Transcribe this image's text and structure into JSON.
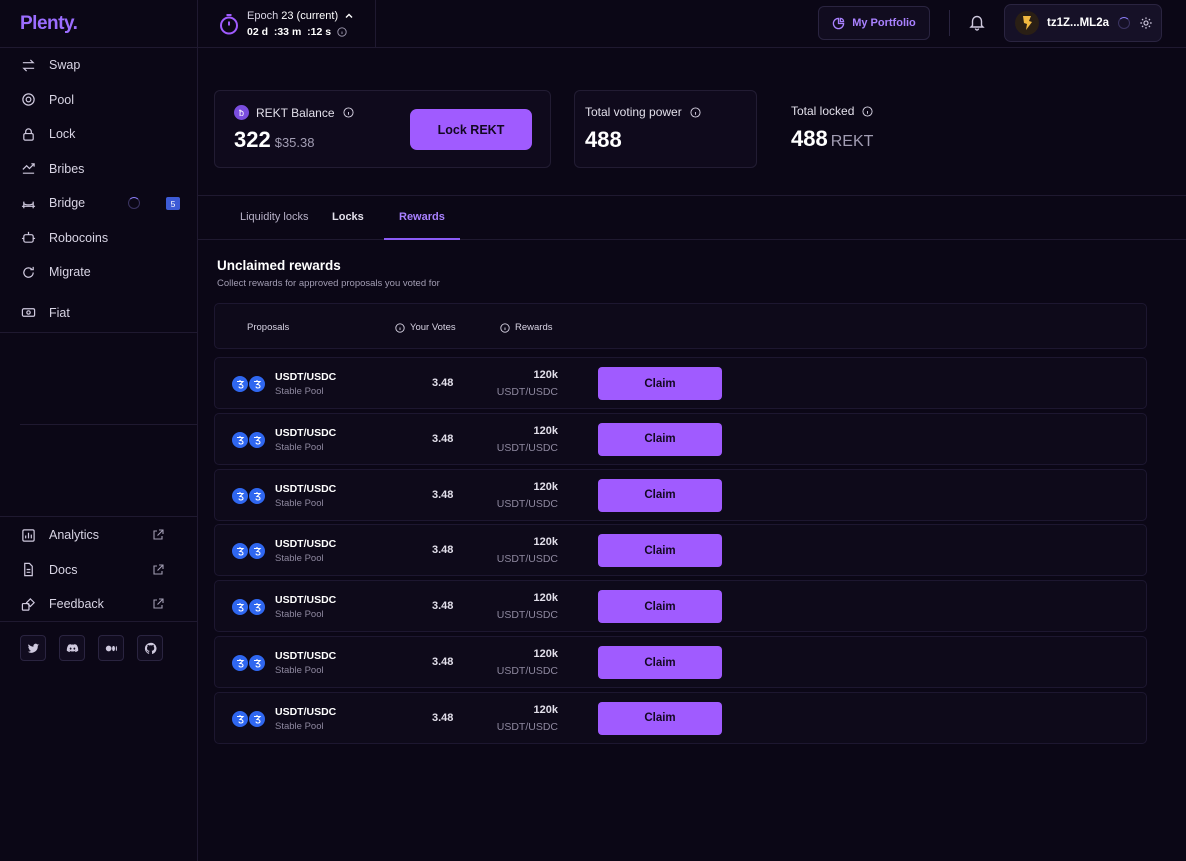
{
  "brand": {
    "logo": "Plenty."
  },
  "sidebar": {
    "items": [
      {
        "label": "Swap",
        "icon": "swap-icon"
      },
      {
        "label": "Pool",
        "icon": "pool-icon"
      },
      {
        "label": "Lock",
        "icon": "lock-icon"
      },
      {
        "label": "Bribes",
        "icon": "bribes-icon"
      },
      {
        "label": "Bridge",
        "icon": "bridge-icon",
        "badge": "5"
      },
      {
        "label": "Robocoins",
        "icon": "robot-icon"
      },
      {
        "label": "Migrate",
        "icon": "migrate-icon"
      },
      {
        "label": "Fiat",
        "icon": "fiat-icon"
      }
    ],
    "bottom": [
      {
        "label": "Analytics",
        "icon": "analytics-icon"
      },
      {
        "label": "Docs",
        "icon": "docs-icon"
      },
      {
        "label": "Feedback",
        "icon": "feedback-icon"
      }
    ],
    "socials": [
      "twitter-icon",
      "discord-icon",
      "medium-icon",
      "github-icon"
    ]
  },
  "header": {
    "epoch_label": "Epoch",
    "epoch_number": "23 (current)",
    "epoch_time": "02 d  :33 m  :12 s",
    "portfolio": "My Portfolio",
    "wallet_address": "tz1Z...ML2a"
  },
  "stats": {
    "balance_label": "REKT Balance",
    "balance_value": "322",
    "balance_usd": "$35.38",
    "lock_button": "Lock REKT",
    "voting_label": "Total voting power",
    "voting_value": "488",
    "locked_label": "Total locked",
    "locked_value": "488",
    "locked_unit": "REKT"
  },
  "tabs": [
    "Liquidity locks",
    "Locks",
    "Rewards"
  ],
  "rewards": {
    "title": "Unclaimed rewards",
    "subtitle": "Collect rewards for approved proposals you voted for",
    "columns": [
      "Proposals",
      "Your Votes",
      "Rewards"
    ],
    "rows": [
      {
        "pool": "USDT/USDC",
        "type": "Stable Pool",
        "votes": "3.48",
        "reward": "120k",
        "reward_token": "USDT/USDC",
        "action": "Claim"
      },
      {
        "pool": "USDT/USDC",
        "type": "Stable Pool",
        "votes": "3.48",
        "reward": "120k",
        "reward_token": "USDT/USDC",
        "action": "Claim"
      },
      {
        "pool": "USDT/USDC",
        "type": "Stable Pool",
        "votes": "3.48",
        "reward": "120k",
        "reward_token": "USDT/USDC",
        "action": "Claim"
      },
      {
        "pool": "USDT/USDC",
        "type": "Stable Pool",
        "votes": "3.48",
        "reward": "120k",
        "reward_token": "USDT/USDC",
        "action": "Claim"
      },
      {
        "pool": "USDT/USDC",
        "type": "Stable Pool",
        "votes": "3.48",
        "reward": "120k",
        "reward_token": "USDT/USDC",
        "action": "Claim"
      },
      {
        "pool": "USDT/USDC",
        "type": "Stable Pool",
        "votes": "3.48",
        "reward": "120k",
        "reward_token": "USDT/USDC",
        "action": "Claim"
      },
      {
        "pool": "USDT/USDC",
        "type": "Stable Pool",
        "votes": "3.48",
        "reward": "120k",
        "reward_token": "USDT/USDC",
        "action": "Claim"
      }
    ]
  },
  "colors": {
    "accent": "#a05bff",
    "background": "#0b0716",
    "token": "#2f67f0"
  }
}
